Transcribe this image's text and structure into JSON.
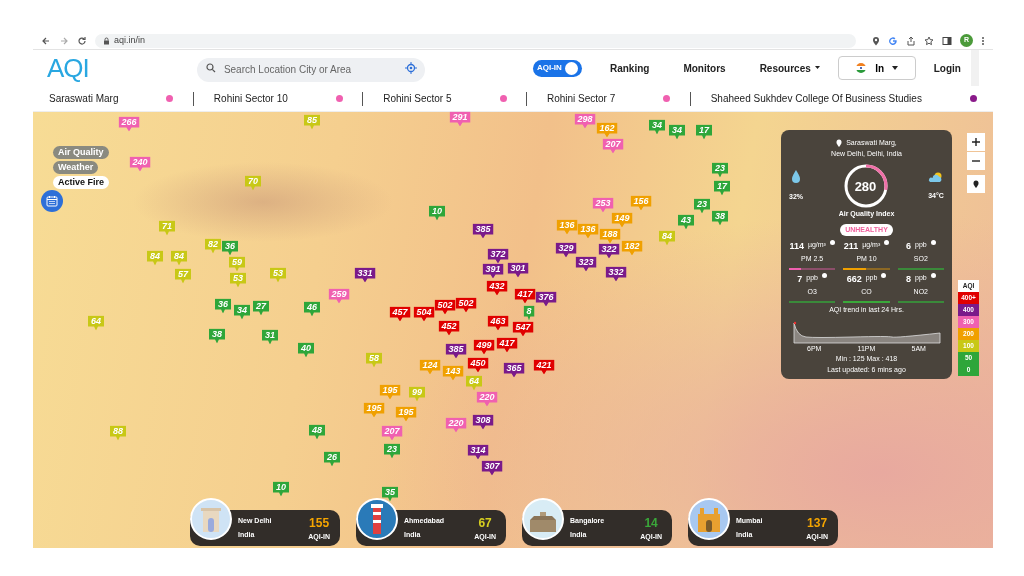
{
  "browser": {
    "url": "aqi.in/in",
    "avatar": "R"
  },
  "header": {
    "logo": "AQI",
    "search_placeholder": "Search Location City or Area",
    "toggle": {
      "label": "AQI-IN",
      "on": true
    },
    "nav": [
      {
        "label": "Ranking",
        "dropdown": false
      },
      {
        "label": "Monitors",
        "dropdown": false
      },
      {
        "label": "Resources",
        "dropdown": true
      }
    ],
    "language": "In",
    "login": "Login"
  },
  "ticker": [
    {
      "name": "Saraswati Marg",
      "color": "#f060b0"
    },
    {
      "name": "Rohini Sector 10",
      "color": "#f060b0"
    },
    {
      "name": "Rohini Sector 5",
      "color": "#f060b0"
    },
    {
      "name": "Rohini Sector 7",
      "color": "#f060b0"
    },
    {
      "name": "Shaheed Sukhdev College Of Business Studies",
      "color": "#8a1a8a"
    }
  ],
  "layers": [
    {
      "label": "Air Quality",
      "selected": false
    },
    {
      "label": "Weather",
      "selected": false
    },
    {
      "label": "Active Fire",
      "selected": true
    }
  ],
  "station": {
    "location": "Saraswati Marg,",
    "region": "New Delhi, Delhi, India",
    "aqi": "280",
    "level": 0.28,
    "humidity": "32%",
    "temperature": "34°C",
    "index_label": "Air Quality Index",
    "status": "UNHEALTHY",
    "pollutants": [
      {
        "value": "114",
        "unit": "µg/m³",
        "name": "PM 2.5",
        "level": 0.25,
        "color": "#f060b0"
      },
      {
        "value": "211",
        "unit": "µg/m³",
        "name": "PM 10",
        "level": 0.5,
        "color": "#f0a000"
      },
      {
        "value": "6",
        "unit": "ppb",
        "name": "SO2",
        "level": 1,
        "color": "#3a8a3a"
      },
      {
        "value": "7",
        "unit": "ppb",
        "name": "O3",
        "level": 1,
        "color": "#3a8a3a"
      },
      {
        "value": "662",
        "unit": "ppb",
        "name": "CO",
        "level": 1,
        "color": "#3aa83a"
      },
      {
        "value": "8",
        "unit": "ppb",
        "name": "NO2",
        "level": 1,
        "color": "#3a8a3a"
      }
    ],
    "trend_title": "AQI trend in last 24 Hrs.",
    "trend_labels": [
      "6PM",
      "11PM",
      "5AM"
    ],
    "min_max": "Min : 125 Max : 418",
    "updated": "Last updated: 6 mins ago"
  },
  "legend": {
    "title": "AQI",
    "levels": [
      {
        "label": "400+",
        "color": "#e00000"
      },
      {
        "label": "400",
        "color": "#7a1a8a"
      },
      {
        "label": "300",
        "color": "#f060b0"
      },
      {
        "label": "200",
        "color": "#f0a000"
      },
      {
        "label": "100",
        "color": "#c8c816"
      },
      {
        "label": "50",
        "color": "#2ea63a"
      },
      {
        "label": "0",
        "color": "#2ea63a"
      }
    ]
  },
  "cities": [
    {
      "name": "New Delhi",
      "country": "India",
      "aqi": "155",
      "unit": "AQI-IN",
      "color": "#f5a500"
    },
    {
      "name": "Ahmedabad",
      "country": "India",
      "aqi": "67",
      "unit": "AQI-IN",
      "color": "#d8d020"
    },
    {
      "name": "Bangalore",
      "country": "India",
      "aqi": "14",
      "unit": "AQI-IN",
      "color": "#3aa83a"
    },
    {
      "name": "Mumbai",
      "country": "India",
      "aqi": "137",
      "unit": "AQI-IN",
      "color": "#f5a500"
    }
  ],
  "pins": [
    {
      "value": "266",
      "color": "#f060b0"
    },
    {
      "value": "85",
      "color": "#c8c816"
    },
    {
      "value": "291",
      "color": "#f060b0"
    },
    {
      "value": "298",
      "color": "#f060b0"
    },
    {
      "value": "162",
      "color": "#f0a000"
    },
    {
      "value": "34",
      "color": "#2ea63a"
    },
    {
      "value": "34",
      "color": "#2ea63a"
    },
    {
      "value": "17",
      "color": "#2ea63a"
    },
    {
      "value": "207",
      "color": "#f060b0"
    },
    {
      "value": "240",
      "color": "#f060b0"
    },
    {
      "value": "23",
      "color": "#2ea63a"
    },
    {
      "value": "70",
      "color": "#c8c816"
    },
    {
      "value": "17",
      "color": "#2ea63a"
    },
    {
      "value": "10",
      "color": "#2ea63a"
    },
    {
      "value": "253",
      "color": "#f060b0"
    },
    {
      "value": "156",
      "color": "#f0a000"
    },
    {
      "value": "23",
      "color": "#2ea63a"
    },
    {
      "value": "71",
      "color": "#c8c816"
    },
    {
      "value": "136",
      "color": "#f0a000"
    },
    {
      "value": "149",
      "color": "#f0a000"
    },
    {
      "value": "43",
      "color": "#2ea63a"
    },
    {
      "value": "38",
      "color": "#2ea63a"
    },
    {
      "value": "385",
      "color": "#7a1a8a"
    },
    {
      "value": "136",
      "color": "#f0a000"
    },
    {
      "value": "188",
      "color": "#f0a000"
    },
    {
      "value": "84",
      "color": "#c8c816"
    },
    {
      "value": "84",
      "color": "#c8c816"
    },
    {
      "value": "84",
      "color": "#c8c816"
    },
    {
      "value": "82",
      "color": "#c8c816"
    },
    {
      "value": "36",
      "color": "#2ea63a"
    },
    {
      "value": "372",
      "color": "#7a1a8a"
    },
    {
      "value": "329",
      "color": "#7a1a8a"
    },
    {
      "value": "322",
      "color": "#7a1a8a"
    },
    {
      "value": "182",
      "color": "#f0a000"
    },
    {
      "value": "57",
      "color": "#c8c816"
    },
    {
      "value": "59",
      "color": "#c8c816"
    },
    {
      "value": "53",
      "color": "#c8c816"
    },
    {
      "value": "331",
      "color": "#7a1a8a"
    },
    {
      "value": "391",
      "color": "#7a1a8a"
    },
    {
      "value": "301",
      "color": "#7a1a8a"
    },
    {
      "value": "323",
      "color": "#7a1a8a"
    },
    {
      "value": "332",
      "color": "#7a1a8a"
    },
    {
      "value": "53",
      "color": "#c8c816"
    },
    {
      "value": "432",
      "color": "#e00000"
    },
    {
      "value": "36",
      "color": "#2ea63a"
    },
    {
      "value": "27",
      "color": "#2ea63a"
    },
    {
      "value": "46",
      "color": "#2ea63a"
    },
    {
      "value": "259",
      "color": "#f060b0"
    },
    {
      "value": "502",
      "color": "#e00000"
    },
    {
      "value": "502",
      "color": "#e00000"
    },
    {
      "value": "417",
      "color": "#e00000"
    },
    {
      "value": "376",
      "color": "#7a1a8a"
    },
    {
      "value": "64",
      "color": "#c8c816"
    },
    {
      "value": "34",
      "color": "#2ea63a"
    },
    {
      "value": "457",
      "color": "#e00000"
    },
    {
      "value": "504",
      "color": "#e00000"
    },
    {
      "value": "463",
      "color": "#e00000"
    },
    {
      "value": "8",
      "color": "#2ea63a"
    },
    {
      "value": "38",
      "color": "#2ea63a"
    },
    {
      "value": "31",
      "color": "#2ea63a"
    },
    {
      "value": "452",
      "color": "#e00000"
    },
    {
      "value": "547",
      "color": "#e00000"
    },
    {
      "value": "40",
      "color": "#2ea63a"
    },
    {
      "value": "385",
      "color": "#7a1a8a"
    },
    {
      "value": "499",
      "color": "#e00000"
    },
    {
      "value": "417",
      "color": "#e00000"
    },
    {
      "value": "58",
      "color": "#c8c816"
    },
    {
      "value": "124",
      "color": "#f0a000"
    },
    {
      "value": "143",
      "color": "#f0a000"
    },
    {
      "value": "450",
      "color": "#e00000"
    },
    {
      "value": "365",
      "color": "#7a1a8a"
    },
    {
      "value": "421",
      "color": "#e00000"
    },
    {
      "value": "64",
      "color": "#c8c816"
    },
    {
      "value": "195",
      "color": "#f0a000"
    },
    {
      "value": "99",
      "color": "#c8c816"
    },
    {
      "value": "220",
      "color": "#f060b0"
    },
    {
      "value": "195",
      "color": "#f0a000"
    },
    {
      "value": "195",
      "color": "#f0a000"
    },
    {
      "value": "88",
      "color": "#c8c816"
    },
    {
      "value": "48",
      "color": "#2ea63a"
    },
    {
      "value": "207",
      "color": "#f060b0"
    },
    {
      "value": "220",
      "color": "#f060b0"
    },
    {
      "value": "308",
      "color": "#7a1a8a"
    },
    {
      "value": "23",
      "color": "#2ea63a"
    },
    {
      "value": "314",
      "color": "#7a1a8a"
    },
    {
      "value": "26",
      "color": "#2ea63a"
    },
    {
      "value": "307",
      "color": "#7a1a8a"
    },
    {
      "value": "10",
      "color": "#2ea63a"
    },
    {
      "value": "35",
      "color": "#2ea63a"
    }
  ]
}
